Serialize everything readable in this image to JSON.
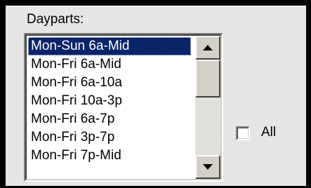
{
  "dayparts": {
    "label": "Dayparts:",
    "items": [
      {
        "label": "Mon-Sun 6a-Mid",
        "selected": true
      },
      {
        "label": "Mon-Fri 6a-Mid",
        "selected": false
      },
      {
        "label": "Mon-Fri 6a-10a",
        "selected": false
      },
      {
        "label": "Mon-Fri 10a-3p",
        "selected": false
      },
      {
        "label": "Mon-Fri 6a-7p",
        "selected": false
      },
      {
        "label": "Mon-Fri 3p-7p",
        "selected": false
      },
      {
        "label": "Mon-Fri 7p-Mid",
        "selected": false
      }
    ]
  },
  "all_checkbox": {
    "label": "All",
    "checked": false
  },
  "icons": {
    "scroll_up": "triangle-up-icon",
    "scroll_down": "triangle-down-icon"
  },
  "colors": {
    "selection": "#0a246a",
    "selection_text": "#ffffff",
    "window_bg": "#e6e6e6",
    "frame": "#000000"
  }
}
